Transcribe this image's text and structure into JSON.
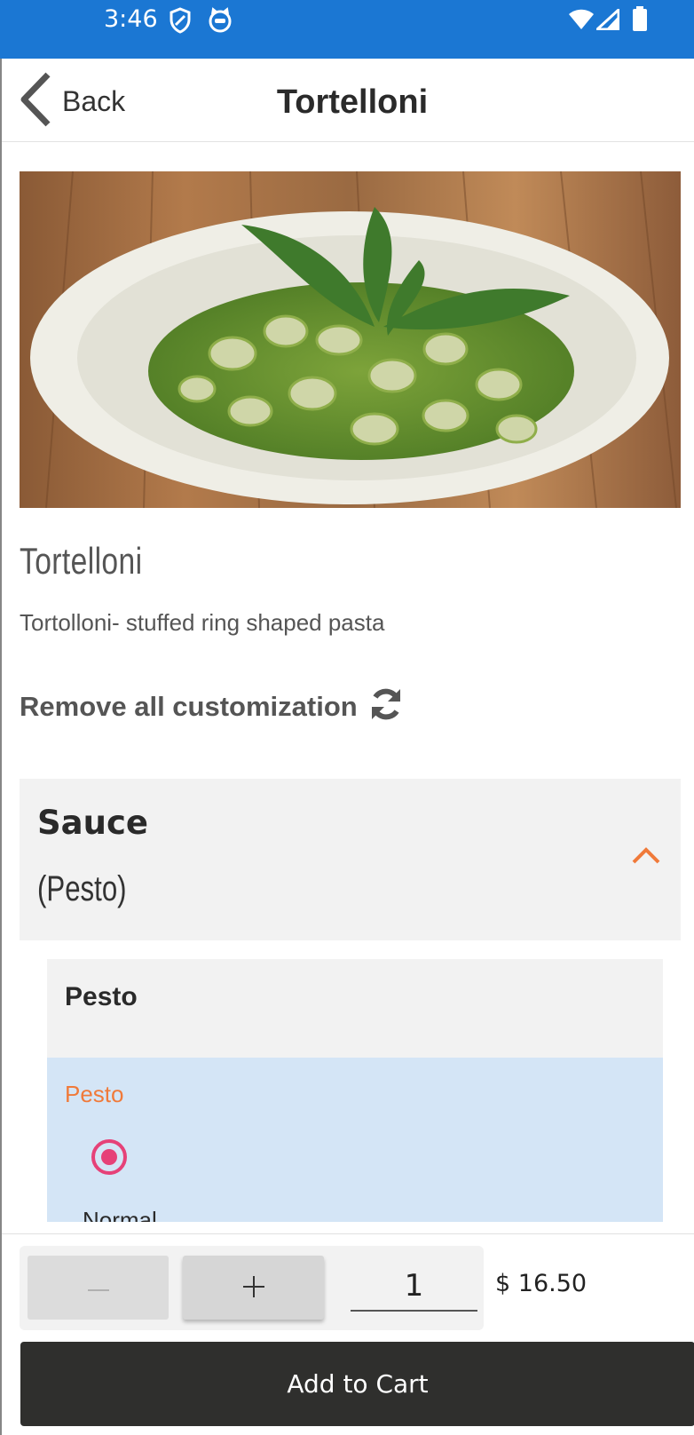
{
  "status_bar": {
    "time": "3:46"
  },
  "header": {
    "back_label": "Back",
    "title": "Tortelloni"
  },
  "item": {
    "name": "Tortelloni",
    "description": "Tortolloni- stuffed ring shaped pasta"
  },
  "remove_customization": {
    "label": "Remove all customization"
  },
  "customization_group": {
    "title": "Sauce",
    "selected": "(Pesto)",
    "option": {
      "heading": "Pesto",
      "sub_label": "Pesto",
      "radio_label": "Normal",
      "selected": true
    }
  },
  "footer": {
    "quantity": "1",
    "price": "$ 16.50",
    "add_to_cart": "Add to Cart"
  },
  "colors": {
    "status_bar": "#1b77d3",
    "accent_orange": "#f07a3a",
    "radio_pink": "#e64178",
    "option_selected_bg": "#d4e5f6",
    "cart_button": "#2f2f2d"
  },
  "icons": [
    "shield-icon",
    "cat-face-icon",
    "wifi-icon",
    "signal-icon",
    "battery-icon",
    "chevron-left-icon",
    "refresh-icon",
    "chevron-up-icon",
    "minus-icon",
    "plus-icon"
  ]
}
